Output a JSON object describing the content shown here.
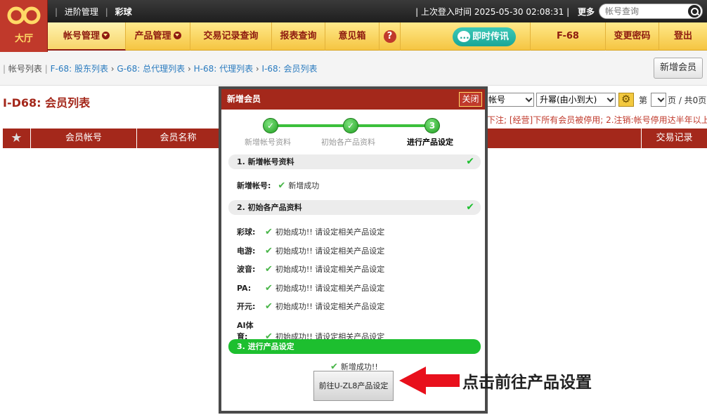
{
  "logo": {
    "label": "大厅"
  },
  "topbar": {
    "left_items": [
      "进阶管理",
      "彩球"
    ],
    "last_login_label": "上次登入时间",
    "last_login_time": "2025-05-30 02:08:31",
    "more": "更多",
    "search_placeholder": "帐号查询"
  },
  "nav": {
    "items": [
      {
        "label": "帐号管理",
        "dropdown": true,
        "active": true
      },
      {
        "label": "产品管理",
        "dropdown": true,
        "active": false
      },
      {
        "label": "交易记录查询"
      },
      {
        "label": "报表查询"
      },
      {
        "label": "意见箱"
      },
      {
        "label": "?"
      }
    ],
    "chat": "即时传讯",
    "account": "F-68",
    "change_password": "变更密码",
    "logout": "登出"
  },
  "breadcrumb": {
    "first": "帐号列表",
    "links": [
      "F-68: 股东列表",
      "G-68: 总代理列表",
      "H-68: 代理列表",
      "I-68: 会员列表"
    ]
  },
  "toolbar": {
    "add_member": "新增会员"
  },
  "page": {
    "title": "I-D68: 会员列表",
    "sort_field": "帐号",
    "sort_order": "升幂(由小到大)",
    "page_label_pre": "第",
    "page_value": "",
    "page_label_post": "页 / 共0页",
    "notice": "下注; [经营]下所有会员被停用; 2.注销:帐号停用达半年以上"
  },
  "table": {
    "headers": [
      "会员帐号",
      "会员名称",
      "交易记录"
    ]
  },
  "modal": {
    "title": "新增会员",
    "close": "关闭",
    "steps": [
      {
        "label": "新增帐号资料",
        "mark": "✓"
      },
      {
        "label": "初始各产品资料",
        "mark": "✓"
      },
      {
        "label": "进行产品设定",
        "mark": "3"
      }
    ],
    "section1": {
      "title": "1. 新增帐号资料",
      "row_label": "新增帐号:",
      "row_msg": "新增成功"
    },
    "section2": {
      "title": "2. 初始各产品资料",
      "rows": [
        {
          "label": "彩球:",
          "msg": "初始成功!! 请设定相关产品设定"
        },
        {
          "label": "电游:",
          "msg": "初始成功!! 请设定相关产品设定"
        },
        {
          "label": "波音:",
          "msg": "初始成功!! 请设定相关产品设定"
        },
        {
          "label": "PA:",
          "msg": "初始成功!! 请设定相关产品设定"
        },
        {
          "label": "开元:",
          "msg": "初始成功!! 请设定相关产品设定"
        },
        {
          "label": "AI体育:",
          "msg": "初始成功!! 请设定相关产品设定"
        }
      ]
    },
    "section3": {
      "title": "3. 进行产品设定",
      "msg": "新增成功!!",
      "button": "前往U-ZL8产品设定"
    }
  },
  "annotation": {
    "text": "点击前往产品设置",
    "arrow_color": "#e8101c"
  },
  "colors": {
    "brand_red": "#a4281b",
    "nav_gold": "#f5c542",
    "success_green": "#1dbf2f"
  }
}
